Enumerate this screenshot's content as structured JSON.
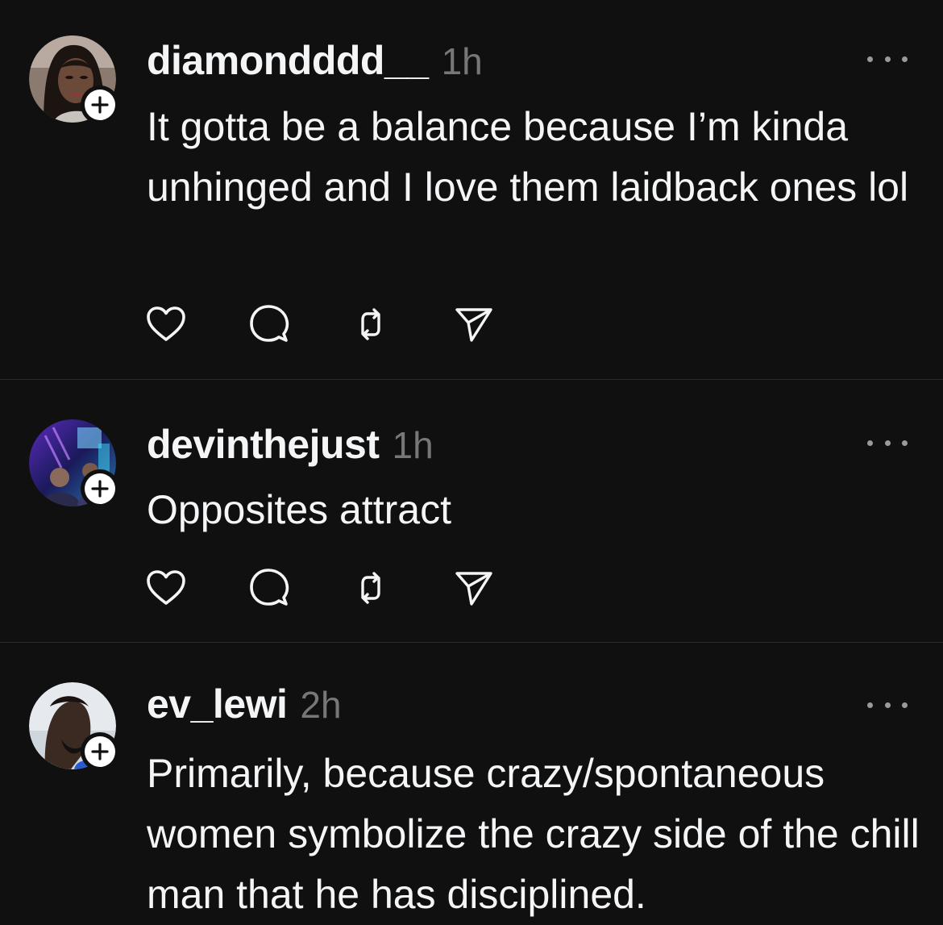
{
  "feed": {
    "posts": [
      {
        "username": "diamondddd__",
        "time": "1h",
        "text": "It gotta be a balance because I’m kinda unhinged and I love them laidback ones lol",
        "avatar": "profile-photo-woman",
        "colors": {
          "avatar_bg": "#7a6a62",
          "avatar_fg": "#2a1c18"
        }
      },
      {
        "username": "devinthejust",
        "time": "1h",
        "text": "Opposites attract",
        "avatar": "profile-photo-neon",
        "colors": {
          "avatar_bg": "#3a2a7a",
          "avatar_fg": "#1a1040"
        }
      },
      {
        "username": "ev_lewi",
        "time": "2h",
        "text": "Primarily, because crazy/spontaneous women symbolize the crazy side of the chill man that he has disciplined.",
        "avatar": "profile-photo-man",
        "colors": {
          "avatar_bg": "#d9dde2",
          "avatar_fg": "#3a2a22"
        }
      }
    ]
  },
  "icons": {
    "like": "heart-icon",
    "reply": "comment-icon",
    "repost": "repost-icon",
    "share": "send-icon",
    "more": "more-icon",
    "follow": "plus-icon"
  },
  "colors": {
    "background": "#101010",
    "text": "#f3f5f7",
    "muted": "#777777",
    "divider": "#2b2b2b"
  }
}
